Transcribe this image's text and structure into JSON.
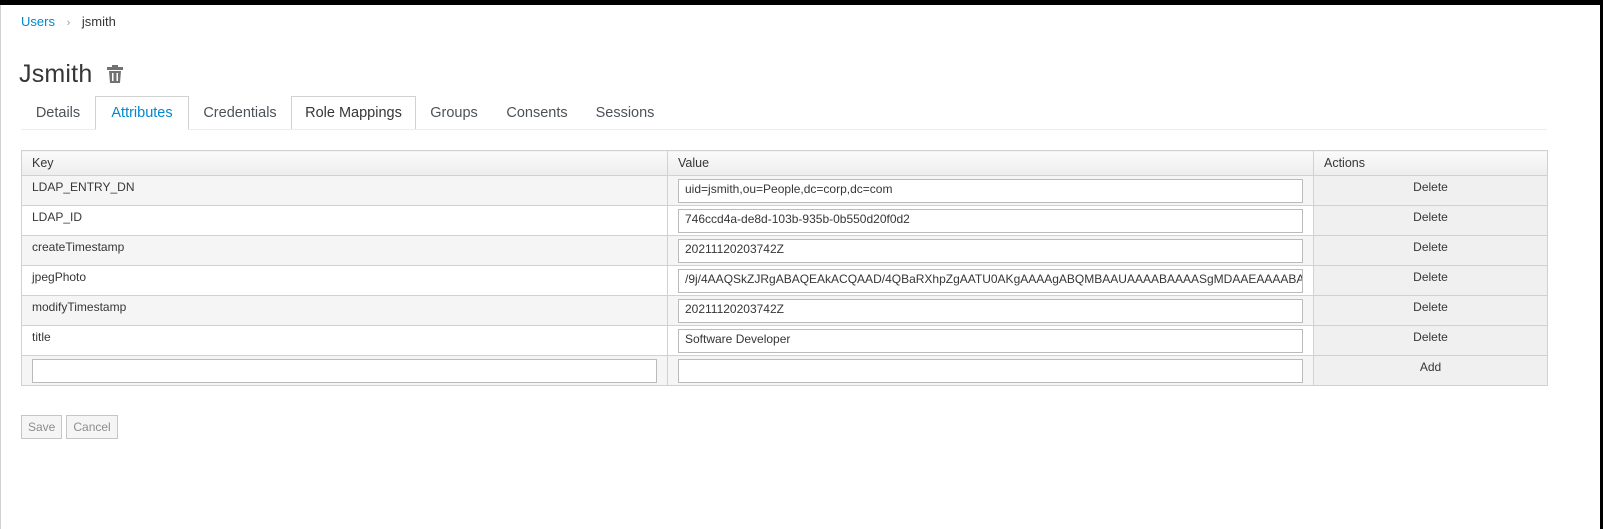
{
  "breadcrumb": {
    "parent": "Users",
    "current": "jsmith"
  },
  "page": {
    "title": "Jsmith",
    "delete_icon": "trash-icon"
  },
  "tabs": [
    {
      "label": "Details"
    },
    {
      "label": "Attributes"
    },
    {
      "label": "Credentials"
    },
    {
      "label": "Role Mappings"
    },
    {
      "label": "Groups"
    },
    {
      "label": "Consents"
    },
    {
      "label": "Sessions"
    }
  ],
  "table": {
    "headers": {
      "key": "Key",
      "value": "Value",
      "actions": "Actions"
    },
    "rows": [
      {
        "key": "LDAP_ENTRY_DN",
        "value": "uid=jsmith,ou=People,dc=corp,dc=com",
        "action": "Delete"
      },
      {
        "key": "LDAP_ID",
        "value": "746ccd4a-de8d-103b-935b-0b550d20f0d2",
        "action": "Delete"
      },
      {
        "key": "createTimestamp",
        "value": "20211120203742Z",
        "action": "Delete"
      },
      {
        "key": "jpegPhoto",
        "value": "/9j/4AAQSkZJRgABAQEAkACQAAD/4QBaRXhpZgAATU0AKgAAAAgABQMBAAUAAAABAAAASgMDAAEAAAABAAAAA",
        "action": "Delete"
      },
      {
        "key": "modifyTimestamp",
        "value": "20211120203742Z",
        "action": "Delete"
      },
      {
        "key": "title",
        "value": "Software Developer",
        "action": "Delete"
      }
    ],
    "new_row": {
      "key": "",
      "value": "",
      "action": "Add"
    }
  },
  "buttons": {
    "save": "Save",
    "cancel": "Cancel"
  },
  "colors": {
    "link": "#0088ce",
    "border": "#d1d1d1",
    "header_bg": "#ededed"
  }
}
